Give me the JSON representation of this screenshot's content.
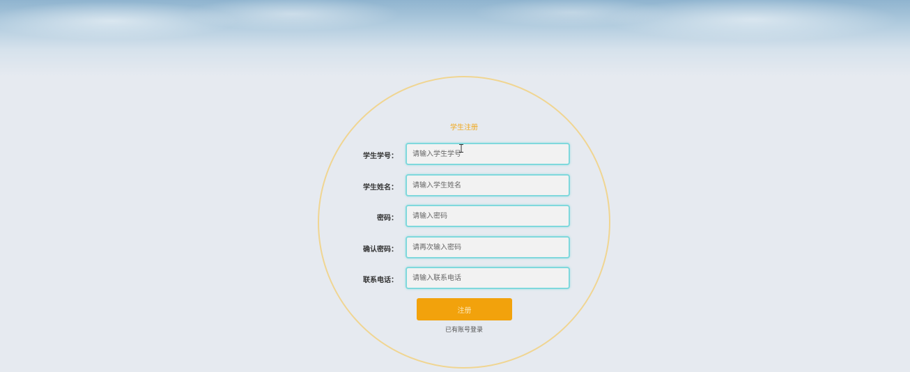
{
  "form": {
    "title": "学生注册",
    "fields": [
      {
        "label": "学生学号：",
        "placeholder": "请输入学生学号",
        "value": ""
      },
      {
        "label": "学生姓名：",
        "placeholder": "请输入学生姓名",
        "value": ""
      },
      {
        "label": "密码：",
        "placeholder": "请输入密码",
        "value": ""
      },
      {
        "label": "确认密码：",
        "placeholder": "请再次输入密码",
        "value": ""
      },
      {
        "label": "联系电话：",
        "placeholder": "请输入联系电话",
        "value": ""
      }
    ],
    "submit_label": "注册",
    "login_link": "已有账号登录"
  },
  "colors": {
    "accent": "#f2a20c",
    "title": "#f0a81c",
    "field_border": "#7fd8dc",
    "circle_border": "#f0d591",
    "background": "#e6eaf0"
  },
  "icons": {
    "text_cursor": "text-cursor-icon"
  }
}
